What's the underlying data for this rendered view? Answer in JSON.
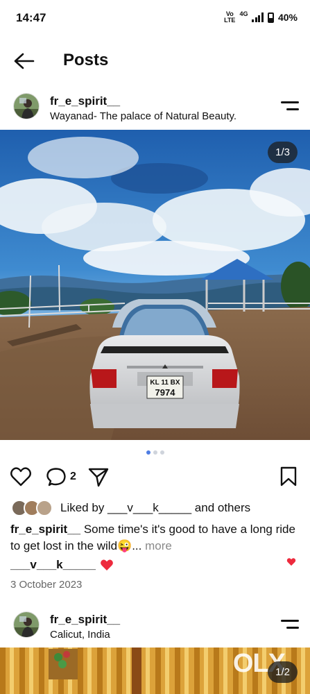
{
  "status_bar": {
    "time": "14:47",
    "volte_top": "Vo",
    "volte_bottom": "LTE",
    "network": "4G",
    "battery": "40%"
  },
  "header": {
    "title": "Posts"
  },
  "post1": {
    "username": "fr_e_spirit__",
    "location": "Wayanad- The palace of Natural Beauty.",
    "photo": {
      "counter": "1/3",
      "plate_top": "KL 11 BX",
      "plate_bottom": "7974"
    },
    "carousel_dots": 3,
    "active_dot": 0,
    "comment_count": "2",
    "likes": {
      "prefix": "Liked by ",
      "user": "___v___k_____",
      "suffix": " and others"
    },
    "caption": {
      "username": "fr_e_spirit__",
      "text": " Some time's it's good to have a long ride to get lost in the wild😜...",
      "more": " more"
    },
    "comment": {
      "user": "___v___k_____"
    },
    "date": "3 October 2023"
  },
  "post2": {
    "username": "fr_e_spirit__",
    "location": "Calicut, India",
    "counter": "1/2",
    "watermark": "OLX"
  },
  "colors": {
    "like_red": "#ed2a3d",
    "dot_active": "#4f7de3",
    "dot_inactive": "#cfd4dc"
  }
}
